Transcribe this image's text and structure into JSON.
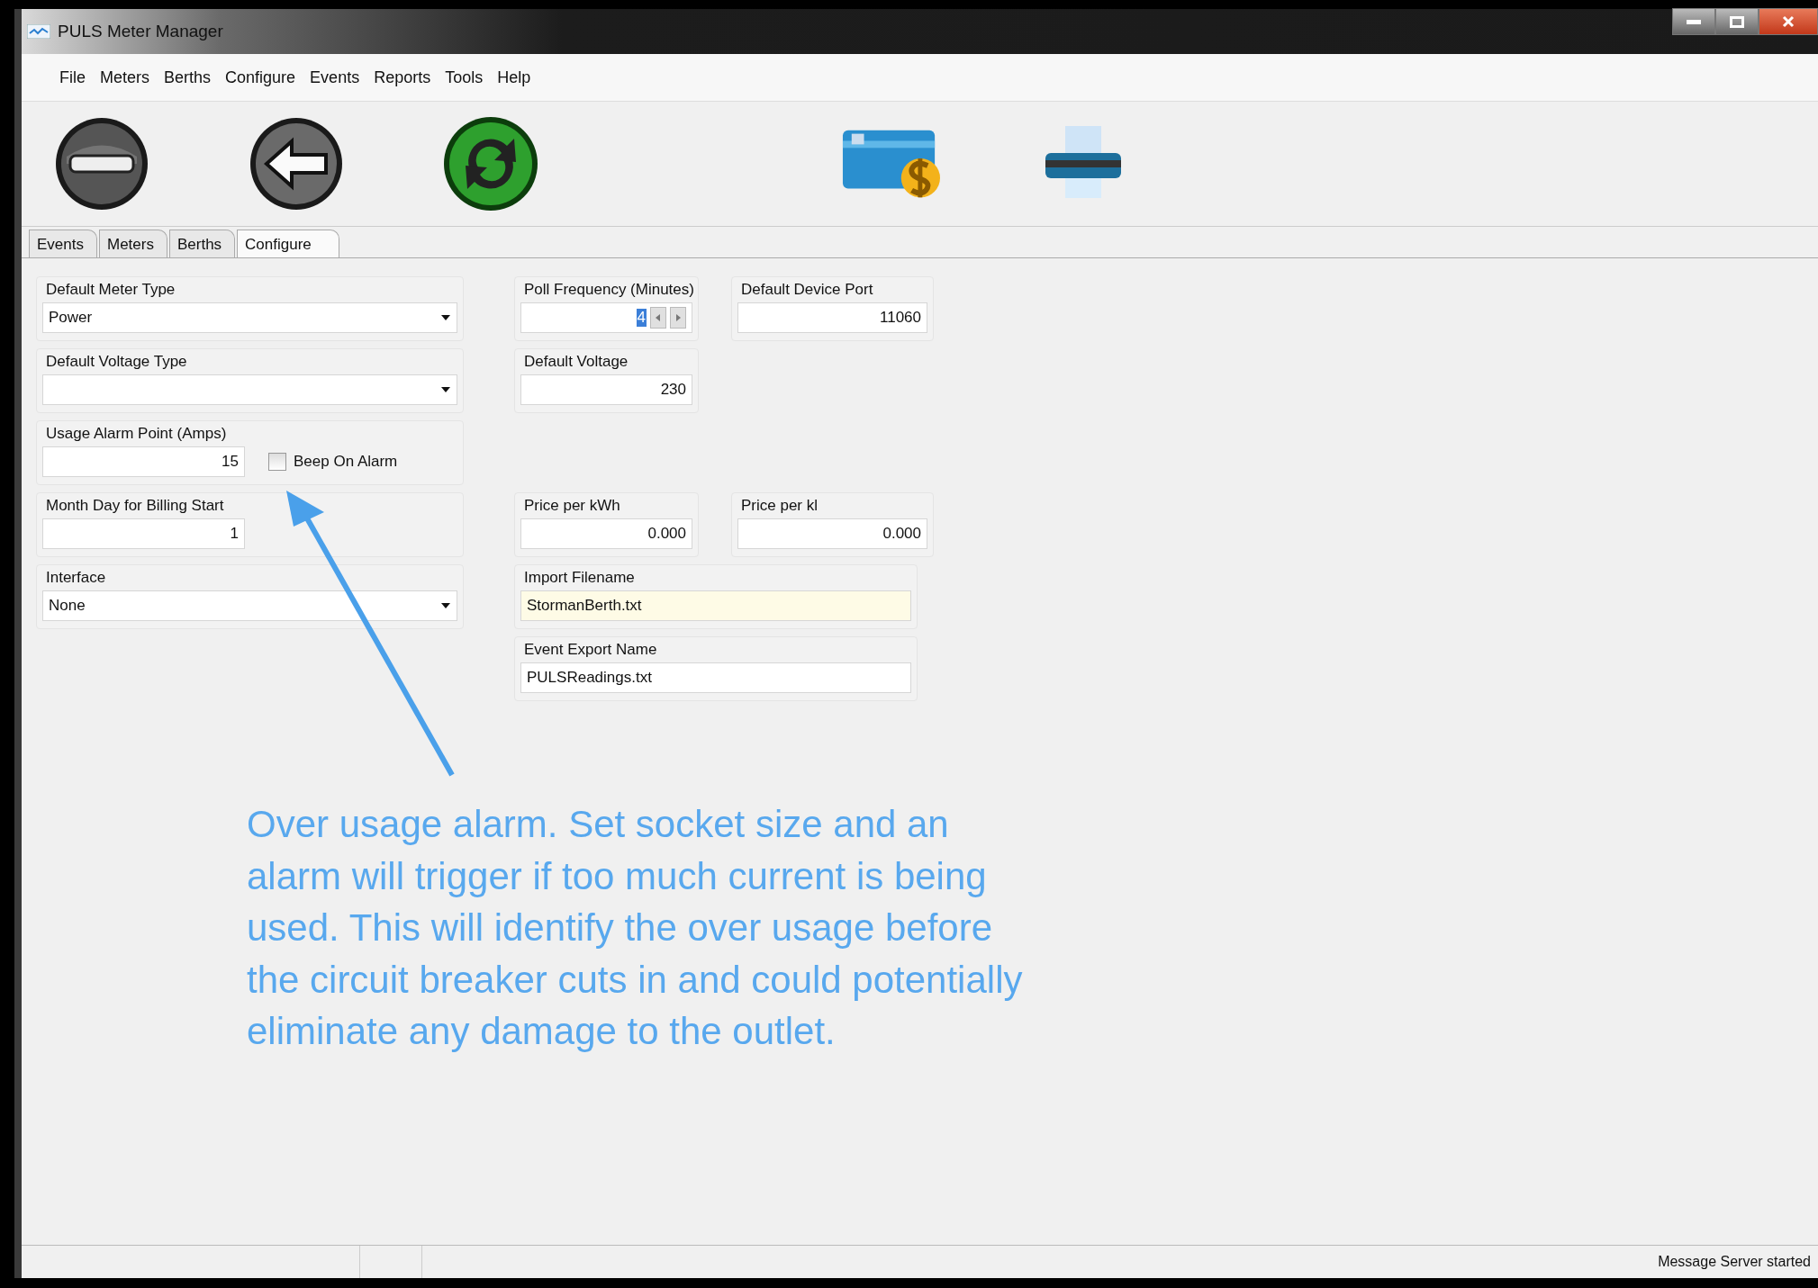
{
  "window": {
    "title": "PULS Meter Manager"
  },
  "menu": [
    "File",
    "Meters",
    "Berths",
    "Configure",
    "Events",
    "Reports",
    "Tools",
    "Help"
  ],
  "tabs": [
    {
      "label": "Events",
      "selected": false
    },
    {
      "label": "Meters",
      "selected": false
    },
    {
      "label": "Berths",
      "selected": false
    },
    {
      "label": "Configure",
      "selected": true
    }
  ],
  "form": {
    "rows": [
      {
        "left": {
          "label": "Default Meter Type",
          "kind": "dropdown",
          "value": "Power"
        },
        "center": {
          "label": "Poll Frequency (Minutes)",
          "kind": "spin",
          "value": "4"
        },
        "right": {
          "label": "Default Device Port",
          "kind": "number",
          "value": "11060"
        }
      },
      {
        "left": {
          "label": "Default Voltage Type",
          "kind": "dropdown"
        },
        "center": {
          "label": "Default Voltage",
          "kind": "number",
          "value": "230"
        }
      },
      {
        "left": {
          "label": "Usage Alarm Point (Amps)",
          "kind": "number",
          "value": "15",
          "checkbox": {
            "label": "Beep On Alarm",
            "checked": false
          }
        }
      },
      {
        "left": {
          "label": "Month Day for Billing Start",
          "kind": "number",
          "value": "1"
        },
        "center": {
          "label": "Price per kWh",
          "kind": "number",
          "value": "0.000"
        },
        "right": {
          "label": "Price per kl",
          "kind": "number",
          "value": "0.000"
        }
      },
      {
        "left": {
          "label": "Interface",
          "kind": "dropdown",
          "value": "None"
        },
        "center": {
          "label": "Import Filename",
          "kind": "text",
          "value": "StormanBerth.txt",
          "highlighted": true
        }
      },
      {
        "center": {
          "label": "Event Export Name",
          "kind": "text",
          "value": "PULSReadings.txt",
          "highlighted": false
        }
      }
    ]
  },
  "annotation": {
    "text": "Over usage alarm. Set socket size and an alarm will trigger if too much current is being used. This will identify the over usage before the circuit breaker cuts in and could potentially eliminate any damage to the outlet."
  },
  "status_bar": {
    "message": "Message Server started"
  }
}
